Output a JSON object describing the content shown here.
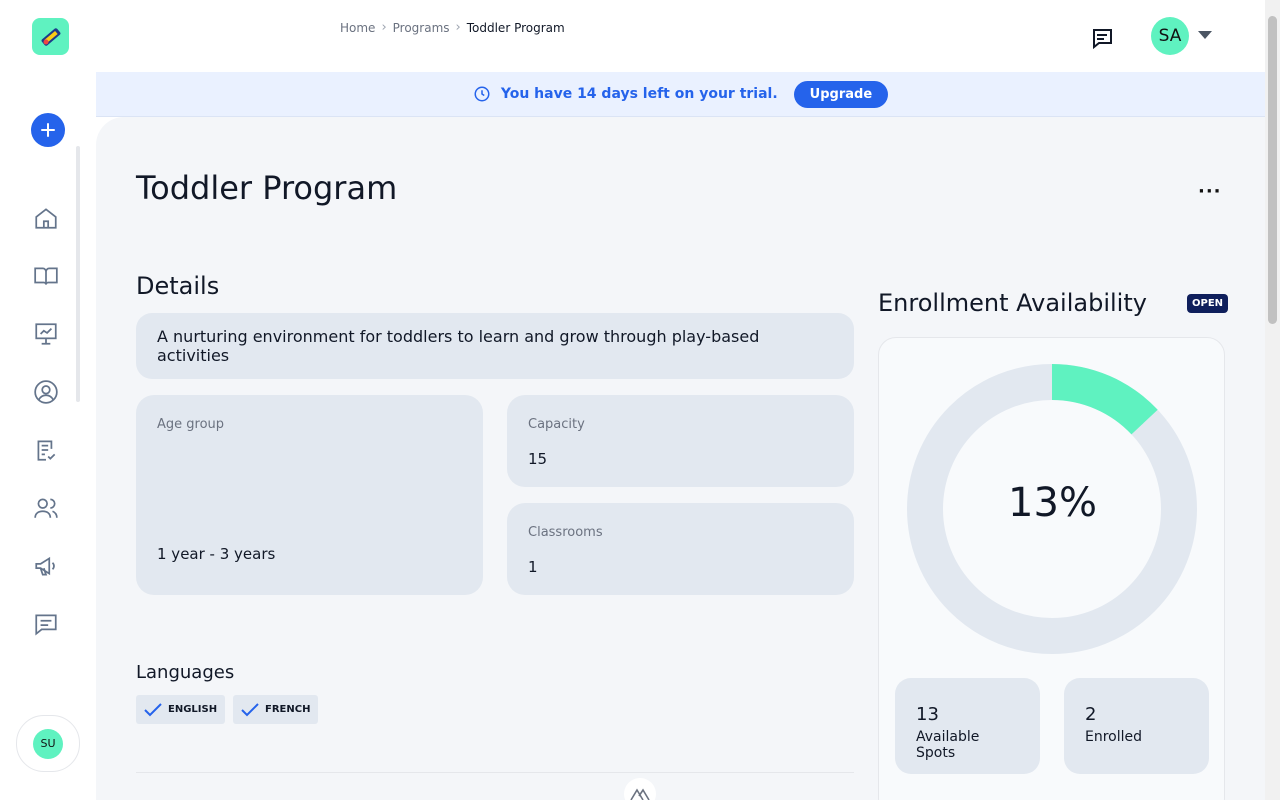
{
  "breadcrumb": {
    "items": [
      "Home",
      "Programs"
    ],
    "current": "Toddler Program"
  },
  "user": {
    "initials": "SA",
    "sidebar_initials": "SU"
  },
  "banner": {
    "message": "You have 14 days left on your trial.",
    "button": "Upgrade"
  },
  "page": {
    "title": "Toddler Program",
    "more": "···"
  },
  "details": {
    "heading": "Details",
    "description": "A nurturing environment for toddlers to learn and grow through play-based activities",
    "age_group": {
      "label": "Age group",
      "value": "1 year - 3 years"
    },
    "capacity": {
      "label": "Capacity",
      "value": "15"
    },
    "classrooms": {
      "label": "Classrooms",
      "value": "1"
    }
  },
  "languages": {
    "heading": "Languages",
    "items": [
      "ENGLISH",
      "FRENCH"
    ]
  },
  "enrollment": {
    "heading": "Enrollment Availability",
    "badge": "OPEN",
    "percent_label": "13%",
    "percent_value": 0.13,
    "available": {
      "value": "13",
      "label": "Available Spots"
    },
    "enrolled": {
      "value": "2",
      "label": "Enrolled"
    }
  },
  "colors": {
    "accent": "#2563eb",
    "mint": "#5ff2c0",
    "navy": "#0f1f5c"
  },
  "sidebar": {
    "icons": [
      "home-icon",
      "book-icon",
      "presentation-icon",
      "user-circle-icon",
      "checklist-icon",
      "people-icon",
      "megaphone-icon",
      "message-icon"
    ]
  }
}
